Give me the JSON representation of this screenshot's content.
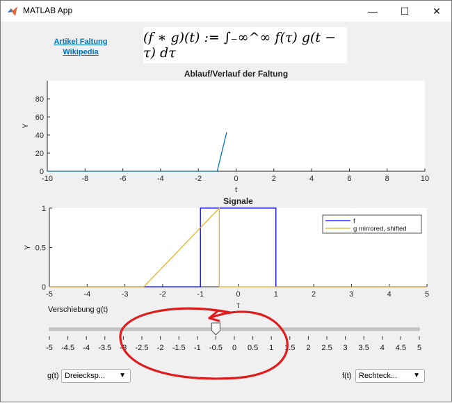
{
  "window": {
    "title": "MATLAB App",
    "minimize": "—",
    "maximize": "☐",
    "close": "✕"
  },
  "link": {
    "line1": "Artikel Faltung",
    "line2": "Wikipedia"
  },
  "formula": "(f ∗ g)(t) := ∫₋∞^∞ f(τ) g(t − τ) dτ",
  "slider": {
    "label": "Verschiebung g(t)",
    "value": -0.5,
    "min": -5,
    "max": 5,
    "ticks": [
      "-5",
      "-4.5",
      "-4",
      "-3.5",
      "-3",
      "-2.5",
      "-2",
      "-1.5",
      "-1",
      "-0.5",
      "0",
      "0.5",
      "1",
      "1.5",
      "2",
      "2.5",
      "3",
      "3.5",
      "4",
      "4.5",
      "5"
    ]
  },
  "g_dropdown": {
    "label": "g(t)",
    "value": "Dreiecksp..."
  },
  "f_dropdown": {
    "label": "f(t)",
    "value": "Rechteck..."
  },
  "chart_data": [
    {
      "type": "line",
      "title": "Ablauf/Verlauf der Faltung",
      "xlabel": "t",
      "ylabel": "Y",
      "xlim": [
        -10,
        10
      ],
      "ylim": [
        0,
        100
      ],
      "xticks": [
        "-10",
        "-8",
        "-6",
        "-4",
        "-2",
        "0",
        "2",
        "4",
        "6",
        "8",
        "10"
      ],
      "yticks": [
        "0",
        "20",
        "40",
        "60",
        "80"
      ],
      "series": [
        {
          "x": [
            -10,
            -1,
            -0.5
          ],
          "y": [
            0,
            0,
            43
          ]
        }
      ],
      "color": "#0072bd"
    },
    {
      "type": "line",
      "title": "Signale",
      "xlabel": "τ",
      "ylabel": "Y",
      "xlim": [
        -5,
        5
      ],
      "ylim": [
        0,
        1
      ],
      "xticks": [
        "-5",
        "-4",
        "-3",
        "-2",
        "-1",
        "0",
        "1",
        "2",
        "3",
        "4",
        "5"
      ],
      "yticks": [
        "0",
        "0.5",
        "1"
      ],
      "legend": "top-right",
      "series": [
        {
          "name": "f",
          "color": "#0000ff",
          "x": [
            -5,
            -1,
            -1,
            1,
            1,
            5
          ],
          "y": [
            0,
            0,
            1,
            1,
            0,
            0
          ]
        },
        {
          "name": "g mirrored, shifted",
          "color": "#edb120",
          "x": [
            -5,
            -2.5,
            -0.5,
            -0.5,
            5
          ],
          "y": [
            0,
            0,
            1,
            0,
            0
          ]
        }
      ]
    }
  ],
  "annotation": {
    "color": "#e01b1b"
  }
}
